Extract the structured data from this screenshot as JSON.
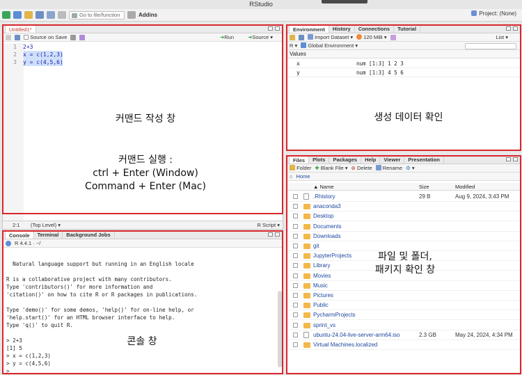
{
  "app": {
    "title": "RStudio",
    "project": "Project: (None)"
  },
  "toolbar": {
    "goto_placeholder": "Go to file/function",
    "addins": "Addins"
  },
  "editor": {
    "tab": "Untitled1*",
    "source_on_save": "Source on Save",
    "run": "Run",
    "source": "Source",
    "lines": [
      {
        "num": "1",
        "text": "2+3"
      },
      {
        "num": "2",
        "text": "x = c(1,2,3)"
      },
      {
        "num": "3",
        "text": "y = c(4,5,6)"
      }
    ],
    "annotation_title": "커맨드 작성 창",
    "annotation_run_title": "커맨드 실행 :",
    "annotation_run_win": "ctrl + Enter (Window)",
    "annotation_run_mac": "Command + Enter (Mac)",
    "status_pos": "2:1",
    "status_level": "(Top Level)",
    "status_type": "R Script"
  },
  "console": {
    "tabs": [
      "Console",
      "Terminal",
      "Background Jobs"
    ],
    "version": "R 4.4.1 · ~/",
    "lines": [
      "  Natural language support but running in an English locale",
      "",
      "R is a collaborative project with many contributors.",
      "Type 'contributors()' for more information and",
      "'citation()' on how to cite R or R packages in publications.",
      "",
      "Type 'demo()' for some demos, 'help()' for on-line help, or",
      "'help.start()' for an HTML browser interface to help.",
      "Type 'q()' to quit R.",
      ""
    ],
    "cmd1": "> 2+3",
    "out1": "[1] 5",
    "cmd2": "> x = c(1,2,3)",
    "cmd3": "> y = c(4,5,6)",
    "prompt": ">",
    "annotation": "콘솔 창"
  },
  "environment": {
    "tabs": [
      "Environment",
      "History",
      "Connections",
      "Tutorial"
    ],
    "import": "Import Dataset",
    "memory": "120 MiB",
    "list": "List",
    "lang": "R",
    "scope": "Global Environment",
    "section": "Values",
    "rows": [
      {
        "name": "x",
        "value": "num [1:3] 1 2 3"
      },
      {
        "name": "y",
        "value": "num [1:3] 4 5 6"
      }
    ],
    "annotation": "생성 데이터 확인"
  },
  "files": {
    "tabs": [
      "Files",
      "Plots",
      "Packages",
      "Help",
      "Viewer",
      "Presentation"
    ],
    "folder": "Folder",
    "blank_file": "Blank File",
    "delete": "Delete",
    "rename": "Rename",
    "home": "Home",
    "col_name": "Name",
    "col_size": "Size",
    "col_modified": "Modified",
    "rows": [
      {
        "name": ".Rhistory",
        "size": "29 B",
        "modified": "Aug 9, 2024, 3:43 PM",
        "kind": "file"
      },
      {
        "name": "anaconda3",
        "size": "",
        "modified": "",
        "kind": "folder"
      },
      {
        "name": "Desktop",
        "size": "",
        "modified": "",
        "kind": "folder"
      },
      {
        "name": "Documents",
        "size": "",
        "modified": "",
        "kind": "folder"
      },
      {
        "name": "Downloads",
        "size": "",
        "modified": "",
        "kind": "folder"
      },
      {
        "name": "git",
        "size": "",
        "modified": "",
        "kind": "folder"
      },
      {
        "name": "JupyterProjects",
        "size": "",
        "modified": "",
        "kind": "folder"
      },
      {
        "name": "Library",
        "size": "",
        "modified": "",
        "kind": "folder"
      },
      {
        "name": "Movies",
        "size": "",
        "modified": "",
        "kind": "folder"
      },
      {
        "name": "Music",
        "size": "",
        "modified": "",
        "kind": "folder"
      },
      {
        "name": "Pictures",
        "size": "",
        "modified": "",
        "kind": "folder"
      },
      {
        "name": "Public",
        "size": "",
        "modified": "",
        "kind": "folder"
      },
      {
        "name": "PycharmProjects",
        "size": "",
        "modified": "",
        "kind": "folder"
      },
      {
        "name": "sprint_vs",
        "size": "",
        "modified": "",
        "kind": "folder"
      },
      {
        "name": "ubuntu-24.04-live-server-arm64.iso",
        "size": "2.3 GB",
        "modified": "May 24, 2024, 4:34 PM",
        "kind": "file"
      },
      {
        "name": "Virtual Machines.localized",
        "size": "",
        "modified": "",
        "kind": "folder"
      }
    ],
    "annotation_line1": "파일 및 폴더,",
    "annotation_line2": "패키지 확인 창"
  },
  "colors": {
    "highlight": "#d9262c",
    "accent": "#1c47a0",
    "folder": "#f3b84a"
  }
}
